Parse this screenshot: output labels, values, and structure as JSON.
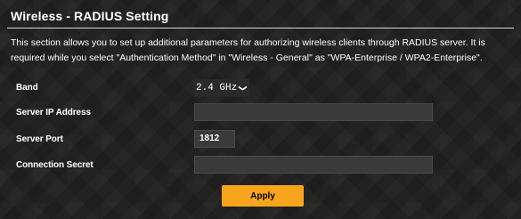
{
  "header": {
    "title": "Wireless - RADIUS Setting"
  },
  "description": "This section allows you to set up additional parameters for authorizing wireless clients through RADIUS server. It is required while you select \"Authentication Method\" in \"Wireless - General\" as \"WPA-Enterprise / WPA2-Enterprise\".",
  "fields": {
    "band": {
      "label": "Band",
      "selected": "2.4 GHz"
    },
    "server_ip": {
      "label": "Server IP Address",
      "value": ""
    },
    "server_port": {
      "label": "Server Port",
      "value": "1812"
    },
    "connection_secret": {
      "label": "Connection Secret",
      "value": ""
    }
  },
  "actions": {
    "apply_label": "Apply"
  },
  "colors": {
    "accent": "#f7a51c",
    "background": "#1e1e1e",
    "text": "#ffffff"
  }
}
